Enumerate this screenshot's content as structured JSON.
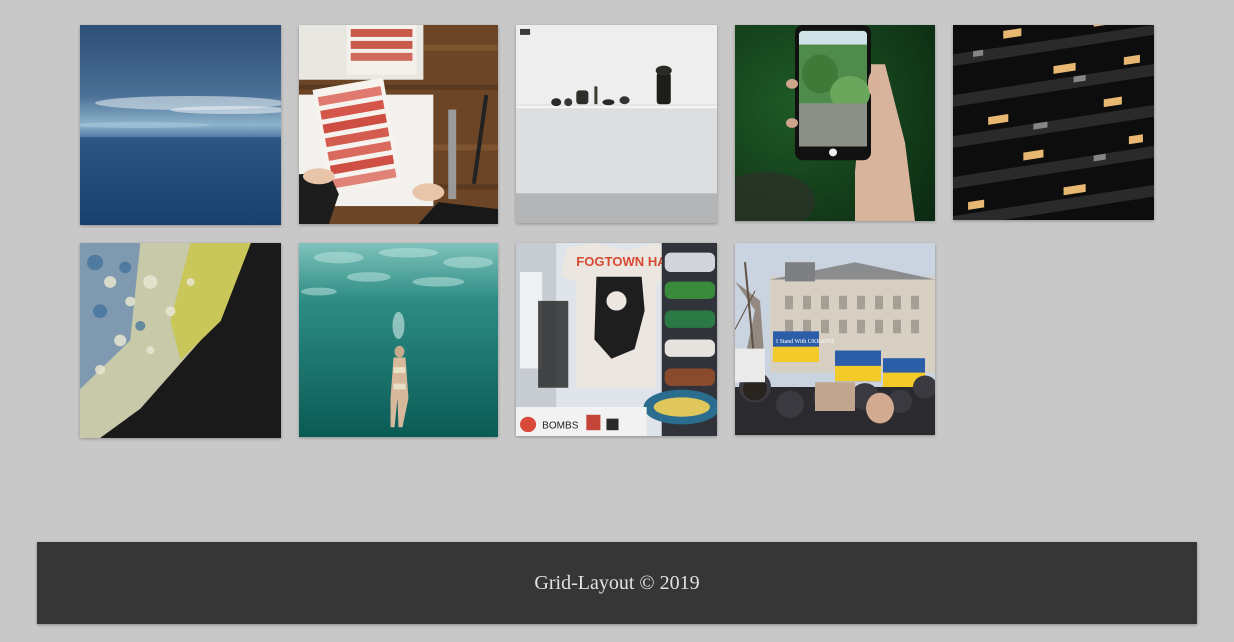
{
  "gallery": {
    "images": [
      {
        "subject": "ocean-horizon-clouds"
      },
      {
        "subject": "color-swatch-book-on-desk"
      },
      {
        "subject": "white-shelf-with-objects"
      },
      {
        "subject": "hand-holding-phone-plants"
      },
      {
        "subject": "dark-building-balconies-lit-windows"
      },
      {
        "subject": "fluid-acrylic-cells-abstract"
      },
      {
        "subject": "underwater-swimmer"
      },
      {
        "subject": "shirt-and-skateboards-shop"
      },
      {
        "subject": "ukraine-protest-crowd"
      }
    ],
    "texts": {
      "shirt_line1": "FOGTOWN HARDCORE",
      "sign_text": "I Stand With UKRAINE",
      "sticker_text": "BOMBS"
    }
  },
  "footer": {
    "text": "Grid-Layout © 2019"
  },
  "colors": {
    "page_bg": "#c8c8c8",
    "footer_bg": "#363636",
    "footer_text": "#e2e2e2"
  }
}
